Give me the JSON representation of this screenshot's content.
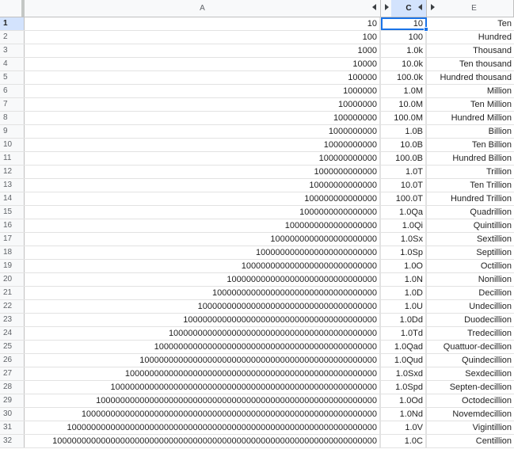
{
  "columns": {
    "a": "A",
    "c": "C",
    "e": "E"
  },
  "rows": [
    {
      "num": "1",
      "a": "10",
      "c": "10",
      "e": "Ten"
    },
    {
      "num": "2",
      "a": "100",
      "c": "100",
      "e": "Hundred"
    },
    {
      "num": "3",
      "a": "1000",
      "c": "1.0k",
      "e": "Thousand"
    },
    {
      "num": "4",
      "a": "10000",
      "c": "10.0k",
      "e": "Ten thousand"
    },
    {
      "num": "5",
      "a": "100000",
      "c": "100.0k",
      "e": "Hundred thousand"
    },
    {
      "num": "6",
      "a": "1000000",
      "c": "1.0M",
      "e": "Million"
    },
    {
      "num": "7",
      "a": "10000000",
      "c": "10.0M",
      "e": "Ten Million"
    },
    {
      "num": "8",
      "a": "100000000",
      "c": "100.0M",
      "e": "Hundred Million"
    },
    {
      "num": "9",
      "a": "1000000000",
      "c": "1.0B",
      "e": "Billion"
    },
    {
      "num": "10",
      "a": "10000000000",
      "c": "10.0B",
      "e": "Ten Billion"
    },
    {
      "num": "11",
      "a": "100000000000",
      "c": "100.0B",
      "e": "Hundred Billion"
    },
    {
      "num": "12",
      "a": "1000000000000",
      "c": "1.0T",
      "e": "Trillion"
    },
    {
      "num": "13",
      "a": "10000000000000",
      "c": "10.0T",
      "e": "Ten Trillion"
    },
    {
      "num": "14",
      "a": "100000000000000",
      "c": "100.0T",
      "e": "Hundred Trillion"
    },
    {
      "num": "15",
      "a": "1000000000000000",
      "c": "1.0Qa",
      "e": "Quadrillion"
    },
    {
      "num": "16",
      "a": "1000000000000000000",
      "c": "1.0Qi",
      "e": "Quintillion"
    },
    {
      "num": "17",
      "a": "1000000000000000000000",
      "c": "1.0Sx",
      "e": "Sextillion"
    },
    {
      "num": "18",
      "a": "1000000000000000000000000",
      "c": "1.0Sp",
      "e": "Septillion"
    },
    {
      "num": "19",
      "a": "1000000000000000000000000000",
      "c": "1.0O",
      "e": "Octillion"
    },
    {
      "num": "20",
      "a": "1000000000000000000000000000000",
      "c": "1.0N",
      "e": "Nonillion"
    },
    {
      "num": "21",
      "a": "1000000000000000000000000000000000",
      "c": "1.0D",
      "e": "Decillion"
    },
    {
      "num": "22",
      "a": "1000000000000000000000000000000000000",
      "c": "1.0U",
      "e": "Undecillion"
    },
    {
      "num": "23",
      "a": "1000000000000000000000000000000000000000",
      "c": "1.0Dd",
      "e": "Duodecillion"
    },
    {
      "num": "24",
      "a": "1000000000000000000000000000000000000000000",
      "c": "1.0Td",
      "e": "Tredecillion"
    },
    {
      "num": "25",
      "a": "1000000000000000000000000000000000000000000000",
      "c": "1.0Qad",
      "e": "Quattuor-decillion"
    },
    {
      "num": "26",
      "a": "1000000000000000000000000000000000000000000000000",
      "c": "1.0Qud",
      "e": "Quindecillion"
    },
    {
      "num": "27",
      "a": "1000000000000000000000000000000000000000000000000000",
      "c": "1.0Sxd",
      "e": "Sexdecillion"
    },
    {
      "num": "28",
      "a": "1000000000000000000000000000000000000000000000000000000",
      "c": "1.0Spd",
      "e": "Septen-decillion"
    },
    {
      "num": "29",
      "a": "1000000000000000000000000000000000000000000000000000000000",
      "c": "1.0Od",
      "e": "Octodecillion"
    },
    {
      "num": "30",
      "a": "1000000000000000000000000000000000000000000000000000000000000",
      "c": "1.0Nd",
      "e": "Novemdecillion"
    },
    {
      "num": "31",
      "a": "1000000000000000000000000000000000000000000000000000000000000000",
      "c": "1.0V",
      "e": "Vigintillion"
    },
    {
      "num": "32",
      "a": "1000000000000000000000000000000000000000000000000000000000000000000",
      "c": "1.0C",
      "e": "Centillion"
    }
  ],
  "icons": {
    "hidden_col_left": "triangle-left",
    "hidden_col_right": "triangle-right"
  },
  "colors": {
    "selection": "#1a73e8",
    "header_selected_bg": "#d3e3fd"
  }
}
